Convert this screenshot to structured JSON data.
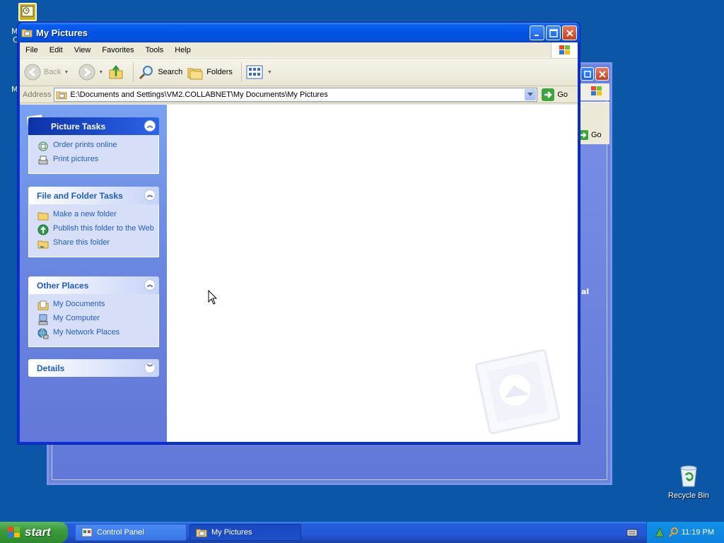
{
  "window": {
    "title": "My Pictures"
  },
  "menu": [
    "File",
    "Edit",
    "View",
    "Favorites",
    "Tools",
    "Help"
  ],
  "toolbar": {
    "back": "Back",
    "search": "Search",
    "folders": "Folders"
  },
  "address": {
    "label": "Address",
    "value": "E:\\Documents and Settings\\VM2.COLLABNET\\My Documents\\My Pictures",
    "go": "Go"
  },
  "panels": {
    "picture_tasks": {
      "title": "Picture Tasks",
      "items": [
        "Order prints online",
        "Print pictures"
      ]
    },
    "file_folder_tasks": {
      "title": "File and Folder Tasks",
      "items": [
        "Make a new folder",
        "Publish this folder to the Web",
        "Share this folder"
      ]
    },
    "other_places": {
      "title": "Other Places",
      "items": [
        "My Documents",
        "My Computer",
        "My Network Places"
      ]
    },
    "details": {
      "title": "Details"
    }
  },
  "background_window": {
    "go": "Go",
    "partial_text": "al"
  },
  "desktop": {
    "recycle_bin": "Recycle Bin",
    "side_letters": [
      "M",
      "C",
      "M"
    ]
  },
  "taskbar": {
    "start": "start",
    "buttons": [
      "Control Panel",
      "My Pictures"
    ],
    "clock": "11:19 PM"
  },
  "colors": {
    "desktop": "#0b56a6",
    "title_bar": "#0454e5",
    "task_pane": "#6a86e0",
    "link": "#215dc6"
  }
}
